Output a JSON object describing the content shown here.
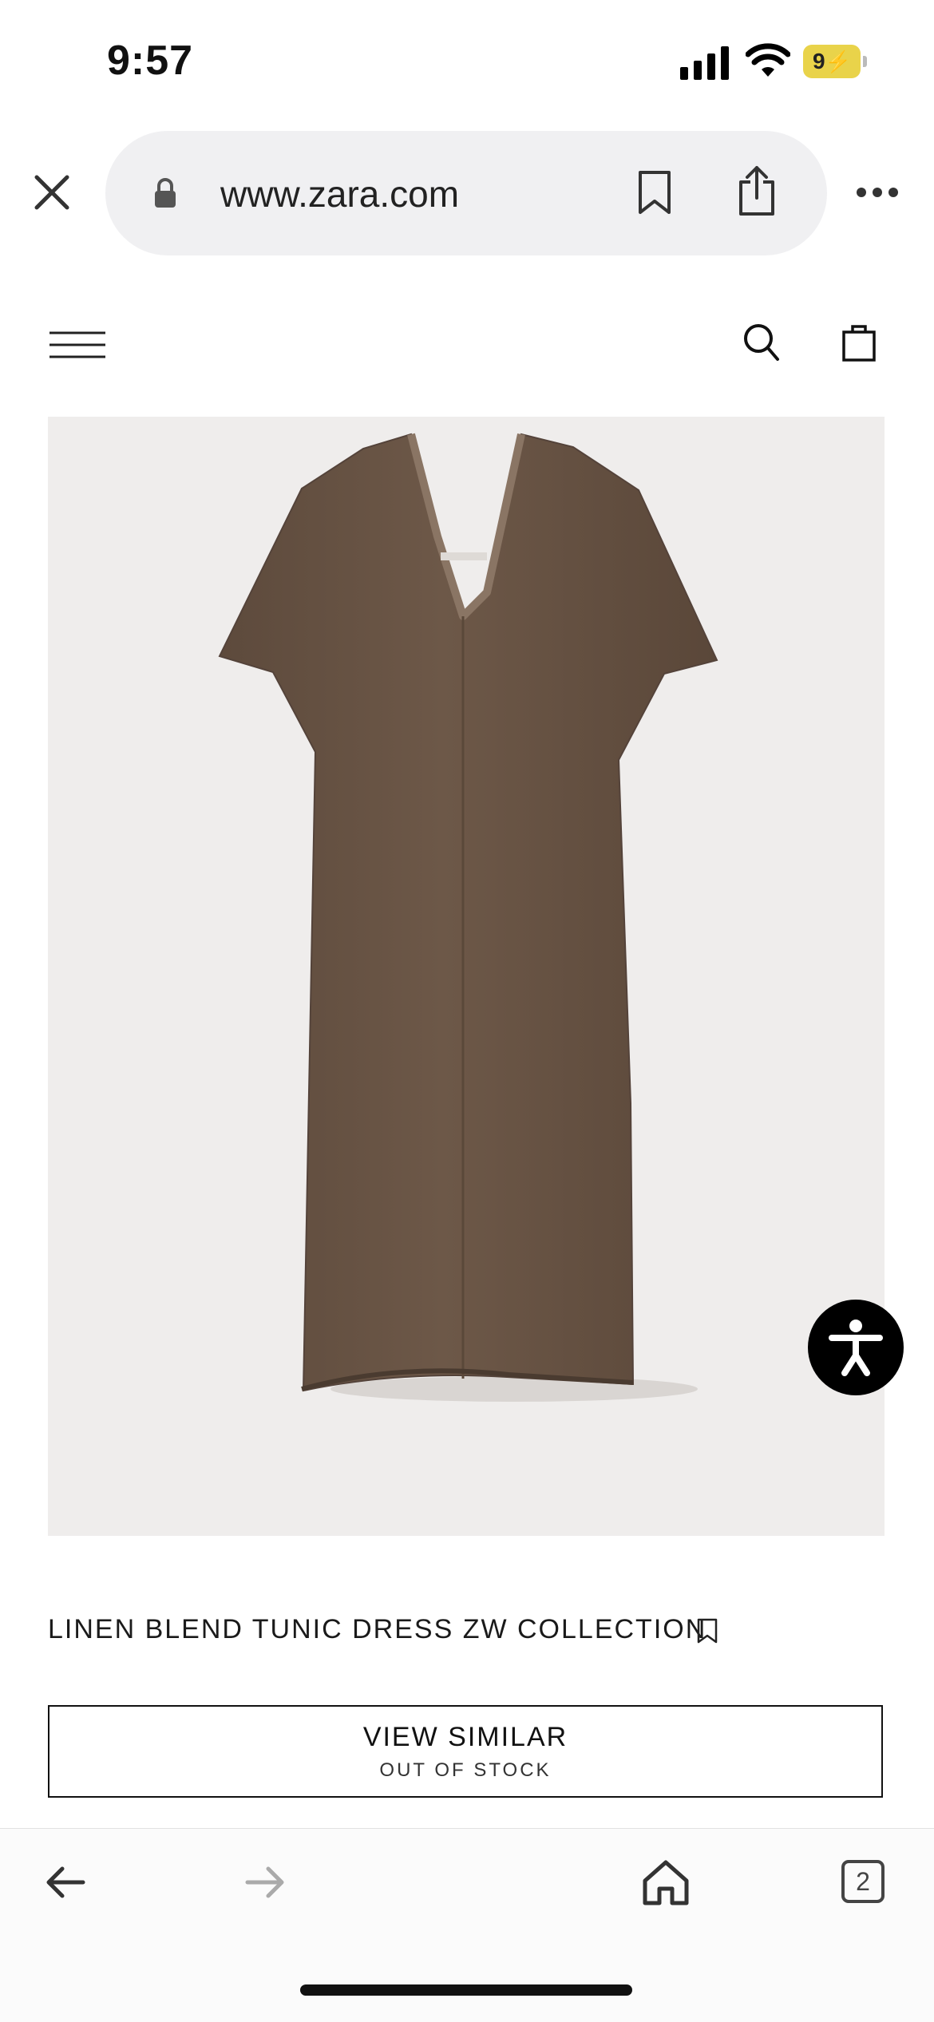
{
  "status_bar": {
    "time": "9:57",
    "battery": "9"
  },
  "browser": {
    "url": "www.zara.com"
  },
  "product": {
    "title": "LINEN BLEND TUNIC DRESS ZW COLLECTION",
    "view_similar_label": "VIEW SIMILAR",
    "stock_status": "OUT OF STOCK"
  },
  "tab_bar": {
    "open_tabs": "2"
  },
  "colors": {
    "background": "#ffffff",
    "image_bg": "#efedec",
    "dress": "#6a5545",
    "battery": "#e9d34a"
  }
}
